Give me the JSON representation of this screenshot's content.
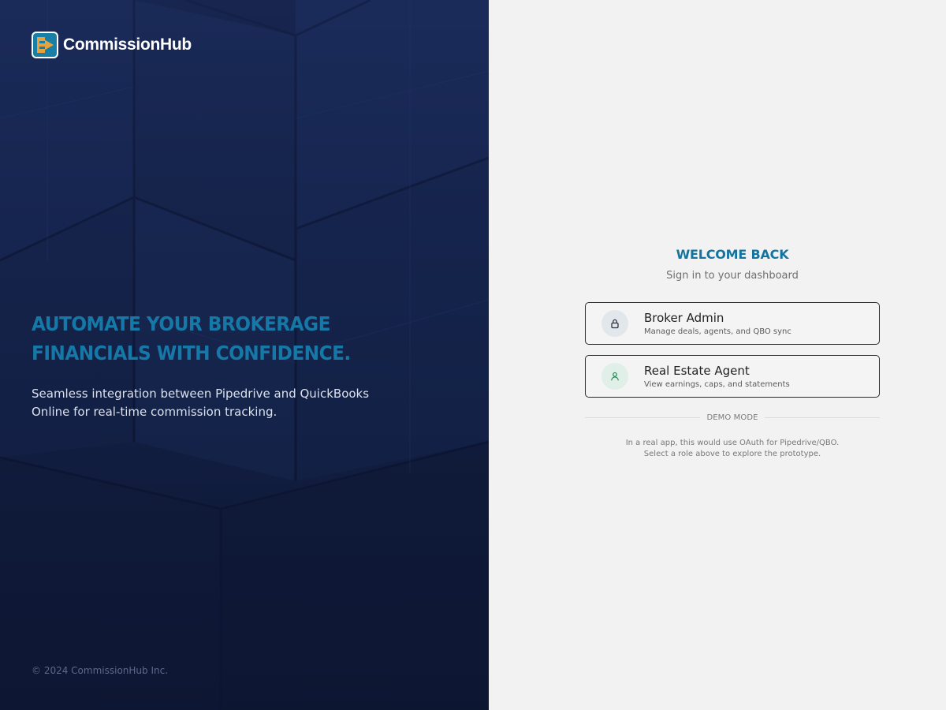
{
  "brand": {
    "name": "CommissionHub",
    "logo_icon": "arrow-badge-icon"
  },
  "hero": {
    "headline_line1": "AUTOMATE YOUR BROKERAGE",
    "headline_line2": "FINANCIALS WITH CONFIDENCE.",
    "subtext_line1": "Seamless integration between Pipedrive and QuickBooks",
    "subtext_line2": "Online for real-time commission tracking.",
    "footer": "© 2024 CommissionHub Inc."
  },
  "auth": {
    "title": "WELCOME BACK",
    "subtitle": "Sign in to your dashboard",
    "roles": [
      {
        "title": "Broker Admin",
        "description": "Manage deals, agents, and QBO sync",
        "icon": "lock-icon"
      },
      {
        "title": "Real Estate Agent",
        "description": "View earnings, caps, and statements",
        "icon": "user-icon"
      }
    ],
    "divider_label": "DEMO MODE",
    "note_line1": "In a real app, this would use OAuth for Pipedrive/QBO.",
    "note_line2": "Select a role above to explore the prototype."
  },
  "colors": {
    "hero_background": "#142247",
    "accent": "#1474a0",
    "logo_orange": "#e9a23b",
    "logo_teal": "#1a7fa6",
    "auth_background": "#f2f2f2"
  }
}
